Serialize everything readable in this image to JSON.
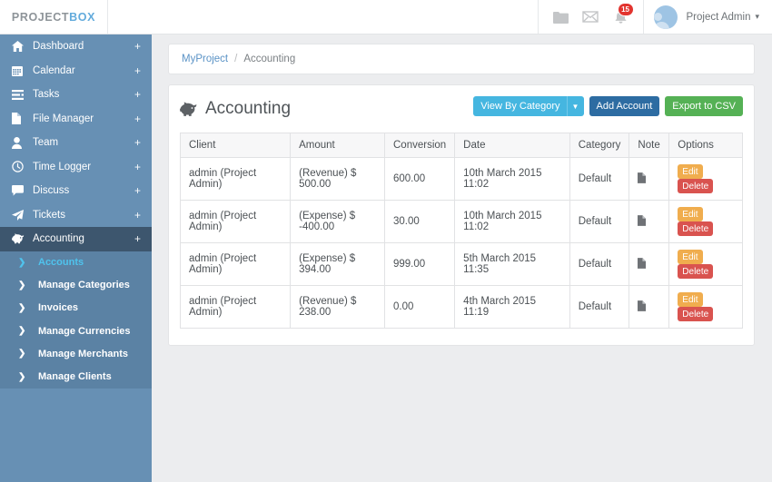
{
  "topbar": {
    "logo_part1": "PROJECT",
    "logo_part2": "BOX",
    "icons": [
      {
        "name": "folder-icon",
        "label": "Files"
      },
      {
        "name": "envelope-icon",
        "label": "Messages"
      },
      {
        "name": "bell-icon",
        "label": "Notifications",
        "badge": "15"
      }
    ],
    "user_name": "Project Admin",
    "user_caret": "✓"
  },
  "sidebar": {
    "items": [
      {
        "label": "Dashboard",
        "icon": "home-icon",
        "expand": "+",
        "active": false
      },
      {
        "label": "Calendar",
        "icon": "calendar-icon",
        "expand": "+",
        "active": false
      },
      {
        "label": "Tasks",
        "icon": "tasks-icon",
        "expand": "+",
        "active": false
      },
      {
        "label": "File Manager",
        "icon": "file-icon",
        "expand": "+",
        "active": false
      },
      {
        "label": "Team",
        "icon": "user-icon",
        "expand": "+",
        "active": false
      },
      {
        "label": "Time Logger",
        "icon": "clock-icon",
        "expand": "+",
        "active": false
      },
      {
        "label": "Discuss",
        "icon": "comment-icon",
        "expand": "+",
        "active": false
      },
      {
        "label": "Tickets",
        "icon": "paper-plane-icon",
        "expand": "+",
        "active": false
      },
      {
        "label": "Accounting",
        "icon": "piggy-bank-icon",
        "expand": "+",
        "active": true
      }
    ],
    "submenu": [
      {
        "label": "Accounts",
        "current": true
      },
      {
        "label": "Manage Categories",
        "current": false
      },
      {
        "label": "Invoices",
        "current": false
      },
      {
        "label": "Manage Currencies",
        "current": false
      },
      {
        "label": "Manage Merchants",
        "current": false
      },
      {
        "label": "Manage Clients",
        "current": false
      }
    ]
  },
  "breadcrumb": {
    "root": "MyProject",
    "separator": "/",
    "current": "Accounting"
  },
  "page": {
    "title": "Accounting",
    "title_icon": "piggy-bank-icon"
  },
  "actions": {
    "view_by_category": "View By Category",
    "add_account": "Add Account",
    "export_csv": "Export to CSV"
  },
  "table": {
    "columns": [
      "Client",
      "Amount",
      "Conversion",
      "Date",
      "Category",
      "Note",
      "Options"
    ],
    "rows": [
      {
        "client": "admin (Project Admin)",
        "amount": "(Revenue) $ 500.00",
        "conversion": "600.00",
        "date": "10th March 2015 11:02",
        "category": "Default",
        "note_icon": "file-icon",
        "edit": "Edit",
        "delete": "Delete"
      },
      {
        "client": "admin (Project Admin)",
        "amount": "(Expense) $ -400.00",
        "conversion": "30.00",
        "date": "10th March 2015 11:02",
        "category": "Default",
        "note_icon": "file-icon",
        "edit": "Edit",
        "delete": "Delete"
      },
      {
        "client": "admin (Project Admin)",
        "amount": "(Expense) $ 394.00",
        "conversion": "999.00",
        "date": "5th March 2015 11:35",
        "category": "Default",
        "note_icon": "file-icon",
        "edit": "Edit",
        "delete": "Delete"
      },
      {
        "client": "admin (Project Admin)",
        "amount": "(Revenue) $ 238.00",
        "conversion": "0.00",
        "date": "4th March 2015 11:19",
        "category": "Default",
        "note_icon": "file-icon",
        "edit": "Edit",
        "delete": "Delete"
      }
    ]
  },
  "colors": {
    "sidebar_bg": "#6790b4",
    "sidebar_submenu_bg": "#5b82a4",
    "sidebar_active_bg": "#3d566e",
    "accent_blue": "#45b6e0",
    "primary_blue": "#2d6ca2",
    "success_green": "#55b155",
    "edit_orange": "#f0ad4e",
    "delete_red": "#d9534f",
    "badge_red": "#e2342f",
    "link_blue": "#5b93c6",
    "current_cyan": "#4fc3ed"
  }
}
